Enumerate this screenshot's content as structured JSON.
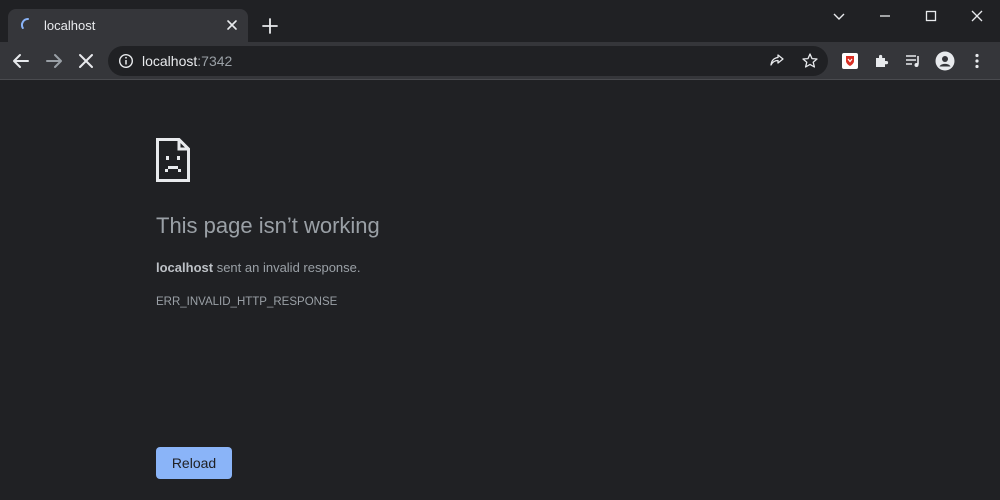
{
  "tab": {
    "title": "localhost"
  },
  "omnibox": {
    "host": "localhost",
    "port": ":7342"
  },
  "error": {
    "title": "This page isn’t working",
    "host": "localhost",
    "message": " sent an invalid response.",
    "code": "ERR_INVALID_HTTP_RESPONSE"
  },
  "reload_label": "Reload",
  "colors": {
    "accent": "#8ab4f8",
    "background": "#202124",
    "toolbar": "#35363a"
  }
}
